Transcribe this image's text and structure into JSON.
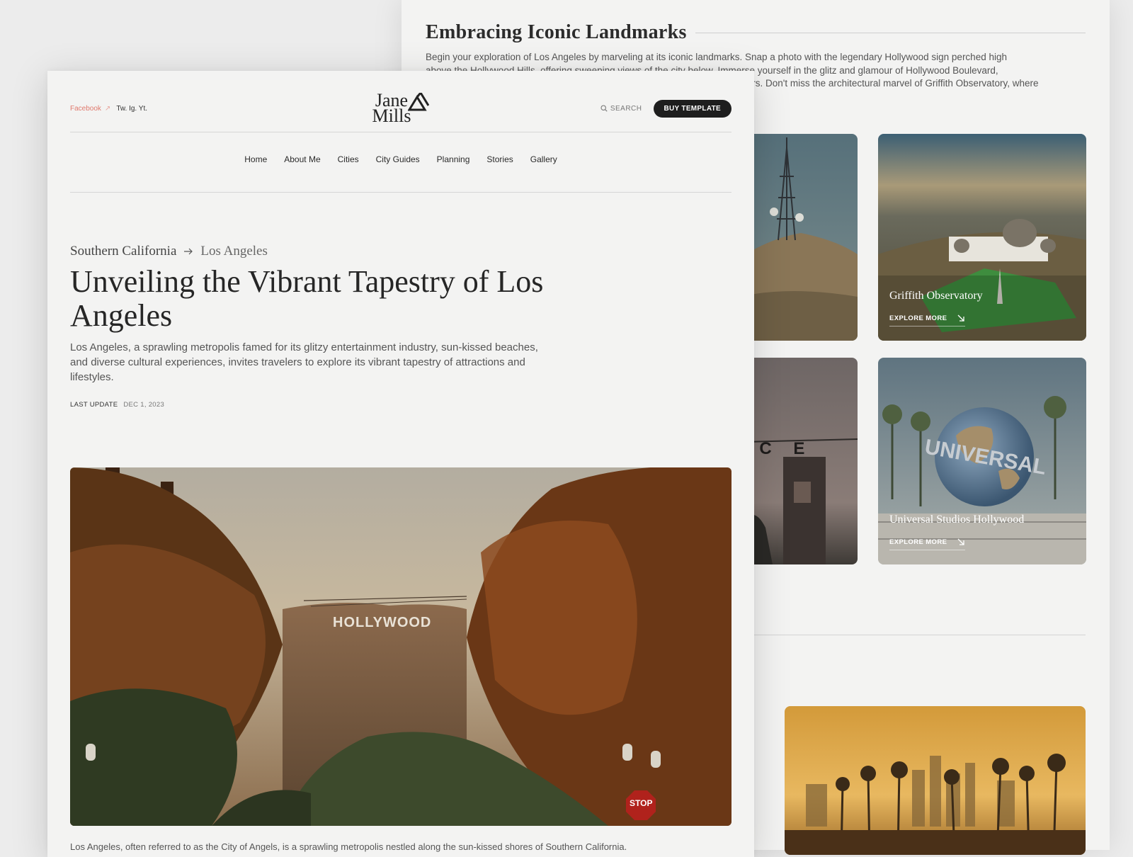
{
  "landmarks_section": {
    "title": "Embracing Iconic Landmarks",
    "paragraph_lines": [
      "Begin your exploration of Los Angeles by marveling at its iconic landmarks. Snap a photo with the legendary Hollywood sign perched high",
      "above the Hollywood Hills, offering sweeping views of the city below. Immerse yourself in the glitz and glamour of Hollywood Boulevard,",
      "tars. Don't miss the architectural marvel of Griffith Observatory, where"
    ],
    "cards": [
      {
        "name": "Griffith Observatory",
        "cta": "EXPLORE MORE"
      },
      {
        "name": "Universal Studios Hollywood",
        "cta": "EXPLORE MORE"
      }
    ],
    "venice_letters": "I C E"
  },
  "header": {
    "socials": {
      "facebook": "Facebook",
      "arrow": "↗",
      "others": "Tw. Ig. Yt."
    },
    "logo": {
      "line1": "Jane",
      "line2": "Mills"
    },
    "search_label": "SEARCH",
    "buy_label": "BUY TEMPLATE"
  },
  "nav": [
    "Home",
    "About Me",
    "Cities",
    "City Guides",
    "Planning",
    "Stories",
    "Gallery"
  ],
  "article": {
    "breadcrumb": {
      "region": "Southern California",
      "city": "Los Angeles"
    },
    "title": "Unveiling the Vibrant Tapestry of Los Angeles",
    "lede": "Los Angeles, a sprawling metropolis famed for its glitzy entertainment industry, sun-kissed beaches, and diverse cultural experiences, invites travelers to explore its vibrant tapestry of attractions and lifestyles.",
    "last_update_label": "LAST UPDATE",
    "last_update_date": "DEC 1, 2023",
    "hero_sign": "HOLLYWOOD",
    "stop_sign": "STOP",
    "body_start": "Los Angeles, often referred to as the City of Angels, is a sprawling metropolis nestled along the sun-kissed shores of Southern California."
  },
  "colors": {
    "accent": "#e07a6e",
    "button": "#1e1e1e",
    "background": "#f3f3f2"
  }
}
